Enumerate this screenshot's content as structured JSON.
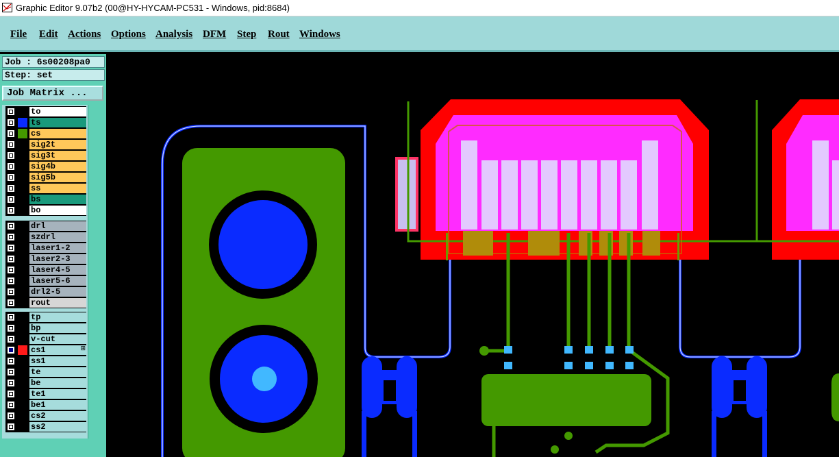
{
  "window": {
    "title": "Graphic Editor 9.07b2 (00@HY-HYCAM-PC531 - Windows, pid:8684)",
    "icon": "graphic-editor-app-icon"
  },
  "menu": [
    {
      "label": "File"
    },
    {
      "label": "Edit"
    },
    {
      "label": "Actions"
    },
    {
      "label": "Options"
    },
    {
      "label": "Analysis"
    },
    {
      "label": "DFM"
    },
    {
      "label": "Step"
    },
    {
      "label": "Rout"
    },
    {
      "label": "Windows"
    }
  ],
  "job": {
    "job_label": "Job : 6s00208pa0",
    "step_label": "Step: set",
    "matrix_button": "Job Matrix ..."
  },
  "colors": {
    "teal_bg": "#9fd9d9",
    "panel_bg": "#5fd0b5",
    "orange_layer": "#ffc85a",
    "teal_layer": "#1a9a7c",
    "gray_layer": "#a6b3bd",
    "blue_trace": "#0a2bff",
    "green_copper": "#449900",
    "red_pad": "#ff0000",
    "magenta": "#ff2bff"
  },
  "layers": {
    "groups": [
      [
        {
          "name": "to",
          "swatch": "",
          "bg": "#ffffff"
        },
        {
          "name": "ts",
          "swatch": "#0a2bff",
          "bg": "#1a9a7c"
        },
        {
          "name": "cs",
          "swatch": "#449900",
          "bg": "#ffc85a"
        },
        {
          "name": "sig2t",
          "swatch": "",
          "bg": "#ffc85a"
        },
        {
          "name": "sig3t",
          "swatch": "",
          "bg": "#ffc85a"
        },
        {
          "name": "sig4b",
          "swatch": "",
          "bg": "#ffc85a"
        },
        {
          "name": "sig5b",
          "swatch": "",
          "bg": "#ffc85a"
        },
        {
          "name": "ss",
          "swatch": "",
          "bg": "#ffc85a"
        },
        {
          "name": "bs",
          "swatch": "",
          "bg": "#1a9a7c"
        },
        {
          "name": "bo",
          "swatch": "",
          "bg": "#ffffff"
        }
      ],
      [
        {
          "name": "drl",
          "swatch": "",
          "bg": "#a6b3bd"
        },
        {
          "name": "szdrl",
          "swatch": "",
          "bg": "#a6b3bd"
        },
        {
          "name": "laser1-2",
          "swatch": "",
          "bg": "#a6b3bd"
        },
        {
          "name": "laser2-3",
          "swatch": "",
          "bg": "#a6b3bd"
        },
        {
          "name": "laser4-5",
          "swatch": "",
          "bg": "#a6b3bd"
        },
        {
          "name": "laser5-6",
          "swatch": "",
          "bg": "#a6b3bd"
        },
        {
          "name": "drl2-5",
          "swatch": "",
          "bg": "#a6b3bd"
        },
        {
          "name": "rout",
          "swatch": "",
          "bg": "#d6d6d6"
        }
      ],
      [
        {
          "name": "tp",
          "swatch": "",
          "bg": "#a6dcdc"
        },
        {
          "name": "bp",
          "swatch": "",
          "bg": "#a6dcdc"
        },
        {
          "name": "v-cut",
          "swatch": "",
          "bg": "#a6dcdc"
        },
        {
          "name": "cs1",
          "swatch": "#ff1a1a",
          "bg": "#a6dcdc",
          "active": true,
          "edit": "⊞"
        },
        {
          "name": "ss1",
          "swatch": "",
          "bg": "#a6dcdc"
        },
        {
          "name": "te",
          "swatch": "",
          "bg": "#a6dcdc"
        },
        {
          "name": "be",
          "swatch": "",
          "bg": "#a6dcdc"
        },
        {
          "name": "te1",
          "swatch": "",
          "bg": "#a6dcdc"
        },
        {
          "name": "be1",
          "swatch": "",
          "bg": "#a6dcdc"
        },
        {
          "name": "cs2",
          "swatch": "",
          "bg": "#a6dcdc"
        },
        {
          "name": "ss2",
          "swatch": "",
          "bg": "#a6dcdc"
        }
      ]
    ]
  }
}
